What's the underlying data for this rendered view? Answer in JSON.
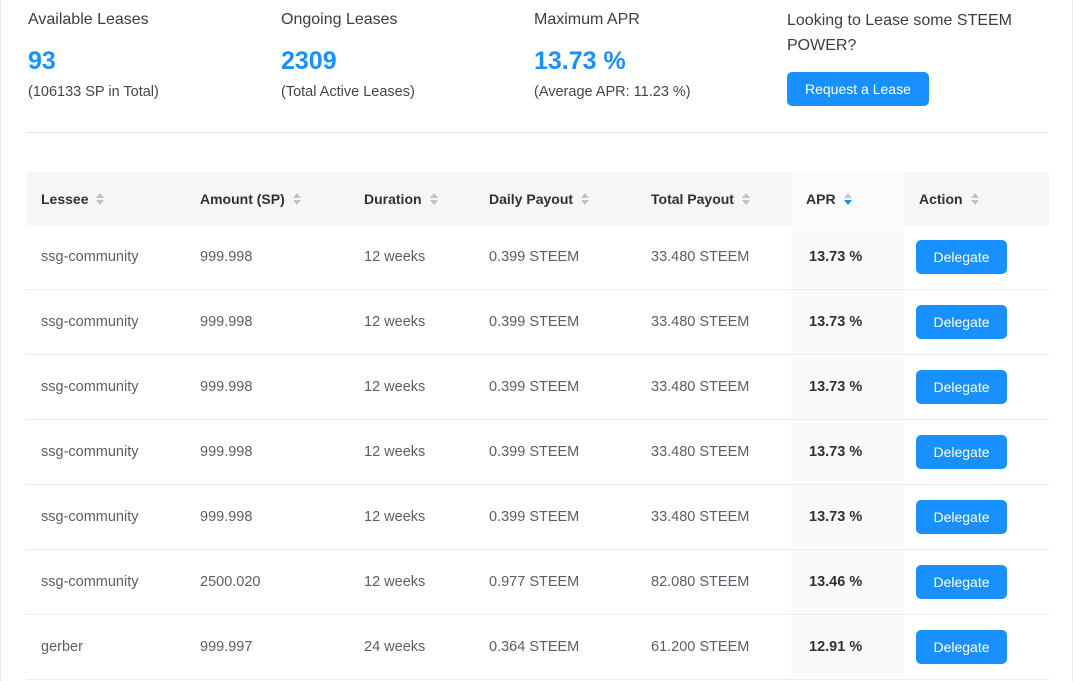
{
  "accent_color": "#1890ff",
  "stats": [
    {
      "label": "Available Leases",
      "value": "93",
      "sub": "(106133 SP in Total)"
    },
    {
      "label": "Ongoing Leases",
      "value": "2309",
      "sub": "(Total Active Leases)"
    },
    {
      "label": "Maximum APR",
      "value": "13.73 %",
      "sub": "(Average APR: 11.23 %)"
    }
  ],
  "cta": {
    "question": "Looking to Lease some STEEM POWER?",
    "button_label": "Request a Lease"
  },
  "table": {
    "columns": [
      {
        "label": "Lessee"
      },
      {
        "label": "Amount (SP)"
      },
      {
        "label": "Duration"
      },
      {
        "label": "Daily Payout"
      },
      {
        "label": "Total Payout"
      },
      {
        "label": "APR",
        "sorted": "desc"
      },
      {
        "label": "Action"
      }
    ],
    "delegate_label": "Delegate",
    "rows": [
      {
        "lessee": "ssg-community",
        "amount_sp": "999.998",
        "duration": "12 weeks",
        "daily_payout": "0.399 STEEM",
        "total_payout": "33.480 STEEM",
        "apr": "13.73 %"
      },
      {
        "lessee": "ssg-community",
        "amount_sp": "999.998",
        "duration": "12 weeks",
        "daily_payout": "0.399 STEEM",
        "total_payout": "33.480 STEEM",
        "apr": "13.73 %"
      },
      {
        "lessee": "ssg-community",
        "amount_sp": "999.998",
        "duration": "12 weeks",
        "daily_payout": "0.399 STEEM",
        "total_payout": "33.480 STEEM",
        "apr": "13.73 %"
      },
      {
        "lessee": "ssg-community",
        "amount_sp": "999.998",
        "duration": "12 weeks",
        "daily_payout": "0.399 STEEM",
        "total_payout": "33.480 STEEM",
        "apr": "13.73 %"
      },
      {
        "lessee": "ssg-community",
        "amount_sp": "999.998",
        "duration": "12 weeks",
        "daily_payout": "0.399 STEEM",
        "total_payout": "33.480 STEEM",
        "apr": "13.73 %"
      },
      {
        "lessee": "ssg-community",
        "amount_sp": "2500.020",
        "duration": "12 weeks",
        "daily_payout": "0.977 STEEM",
        "total_payout": "82.080 STEEM",
        "apr": "13.46 %"
      },
      {
        "lessee": "gerber",
        "amount_sp": "999.997",
        "duration": "24 weeks",
        "daily_payout": "0.364 STEEM",
        "total_payout": "61.200 STEEM",
        "apr": "12.91 %"
      }
    ]
  }
}
